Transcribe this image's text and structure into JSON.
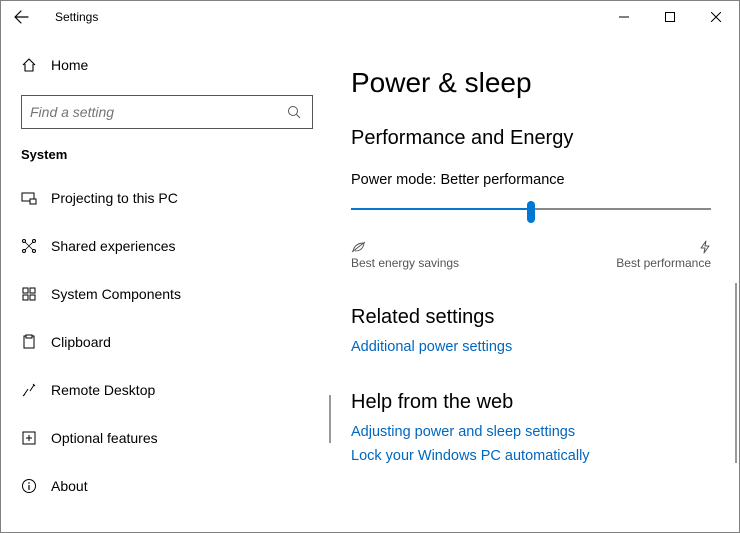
{
  "window": {
    "title": "Settings"
  },
  "sidebar": {
    "home_label": "Home",
    "search_placeholder": "Find a setting",
    "category_label": "System",
    "items": [
      {
        "label": "Projecting to this PC"
      },
      {
        "label": "Shared experiences"
      },
      {
        "label": "System Components"
      },
      {
        "label": "Clipboard"
      },
      {
        "label": "Remote Desktop"
      },
      {
        "label": "Optional features"
      },
      {
        "label": "About"
      }
    ]
  },
  "content": {
    "page_title": "Power & sleep",
    "section1_title": "Performance and Energy",
    "power_mode_label": "Power mode: Better performance",
    "slider_min_label": "Best energy savings",
    "slider_max_label": "Best performance",
    "section2_title": "Related settings",
    "link1": "Additional power settings",
    "section3_title": "Help from the web",
    "link2": "Adjusting power and sleep settings",
    "link3": "Lock your Windows PC automatically"
  }
}
